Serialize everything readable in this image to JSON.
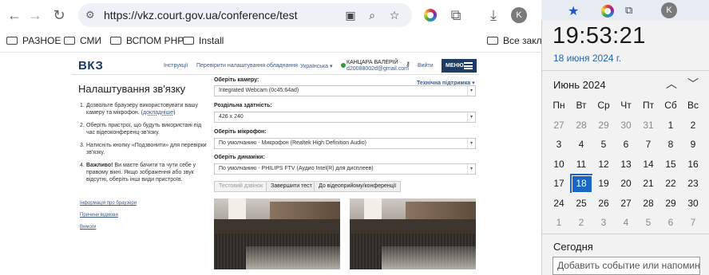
{
  "browser": {
    "url": "https://vkz.court.gov.ua/conference/test",
    "back_icon": "←",
    "forward_icon": "→",
    "reload_icon": "↻",
    "tune_icon": "⚙",
    "camera_icon": "▣",
    "zoom_icon": "⌕",
    "bookmark_star_icon": "☆",
    "puzzle_icon": "⧉",
    "download_icon": "⤓",
    "profile_letter": "K",
    "kebab_icon": "⋮",
    "star_active_icon": "★"
  },
  "bookmarks": [
    {
      "label": "РАЗНОЕ"
    },
    {
      "label": "СМИ"
    },
    {
      "label": "ВСПОМ PHP"
    },
    {
      "label": "Install"
    },
    {
      "label": "Все заклад"
    }
  ],
  "site": {
    "logo": "ВКЗ",
    "links": [
      "Інструкції",
      "Перевірити налаштування обладнання",
      "Українська ▾"
    ],
    "user_name": "КАНЦАРА ВАЛЕРІЙ",
    "user_email": "d20088002d@gmail.com",
    "key_icon": "⚷",
    "logout": "Вийти",
    "menu": "МЕНЮ",
    "page_title": "Налаштування зв'язку",
    "support": "Технічна підтримка ▾",
    "steps": [
      {
        "num": "1.",
        "text": "Дозвольте браузеру використовувати вашу камеру та мікрофон. ",
        "link": "докладніше",
        "tail": ")"
      },
      {
        "num": "2.",
        "text": "Оберіть пристрої, що будуть використані під час відеоконференц-зв'язку."
      },
      {
        "num": "3.",
        "text": "Натисніть кнопку «Подзвонити» для перевірки зв'язку."
      },
      {
        "num": "4.",
        "bold": "Важливо!",
        "text": " Ви маєте бачити та чути себе у правому вікні. Якщо зображення або звук відсутні, оберіть інші види пристроїв."
      }
    ],
    "side_links": [
      "Інформація про браузери",
      "Причини відмови",
      "Вимоги"
    ],
    "fields": [
      {
        "label": "Оберіть камеру:",
        "value": "Integrated Webcam (0c45:64ad)"
      },
      {
        "label": "Роздільна здатність:",
        "value": "426 x 240"
      },
      {
        "label": "Оберіть мікрофон:",
        "value": "По умолчанию - Микрофон (Realtek High Definition Audio)"
      },
      {
        "label": "Оберіть динаміки:",
        "value": "По умолчанию - PHILIPS FTV (Аудио Intel(R) для дисплеев)"
      }
    ],
    "buttons": [
      "Тестовий дзвінок",
      "Завершити тест",
      "До відеоприйому/конференції"
    ]
  },
  "calendar": {
    "time": "19:53:21",
    "date": "18 июня 2024 г.",
    "month": "Июнь 2024",
    "prev_icon": "︿",
    "next_icon": "﹀",
    "weekdays": [
      "Пн",
      "Вт",
      "Ср",
      "Чт",
      "Пт",
      "Сб",
      "Вс"
    ],
    "weeks": [
      [
        "27",
        "28",
        "29",
        "30",
        "31",
        "1",
        "2"
      ],
      [
        "3",
        "4",
        "5",
        "6",
        "7",
        "8",
        "9"
      ],
      [
        "10",
        "11",
        "12",
        "13",
        "14",
        "15",
        "16"
      ],
      [
        "17",
        "18",
        "19",
        "20",
        "21",
        "22",
        "23"
      ],
      [
        "24",
        "25",
        "26",
        "27",
        "28",
        "29",
        "30"
      ],
      [
        "1",
        "2",
        "3",
        "4",
        "5",
        "6",
        "7"
      ]
    ],
    "today_label": "Сегодня",
    "event_placeholder": "Добавить событие или напоминан"
  }
}
